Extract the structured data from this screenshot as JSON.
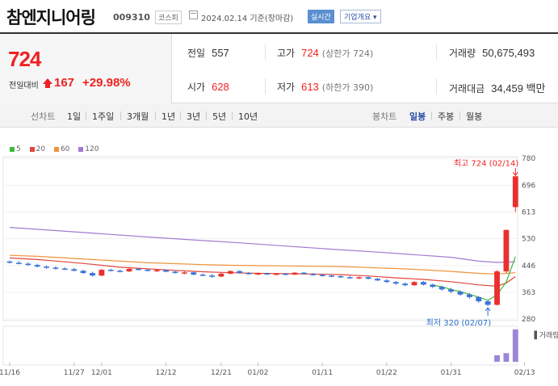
{
  "header": {
    "name": "참엔지니어링",
    "code": "009310",
    "market": "코스피",
    "date": "2024.02.14 기준(장마감)",
    "realtime": "실시간",
    "company_info": "기업개요 ▾"
  },
  "summary": {
    "price": "724",
    "change_label": "전일대비",
    "change": "167",
    "change_pct": "+29.98%",
    "prev_close": {
      "label": "전일",
      "value": "557"
    },
    "high": {
      "label": "고가",
      "value": "724",
      "extra": "(상한가 724)"
    },
    "volume": {
      "label": "거래량",
      "value": "50,675,493"
    },
    "open": {
      "label": "시가",
      "value": "628"
    },
    "low": {
      "label": "저가",
      "value": "613",
      "extra": "(하한가 390)"
    },
    "turnover": {
      "label": "거래대금",
      "value": "34,459 백만"
    }
  },
  "tabs": {
    "line_label": "선차트",
    "line_tabs": [
      "1일",
      "1주일",
      "3개월",
      "1년",
      "3년",
      "5년",
      "10년"
    ],
    "candle_label": "봉차트",
    "candle_tabs": [
      "일봉",
      "주봉",
      "월봉"
    ],
    "active_candle": "일봉"
  },
  "colors": {
    "up": "#e8312f",
    "down": "#3a73d8",
    "ma5": "#3cb83a",
    "ma20": "#e0463c",
    "ma60": "#f0923a",
    "ma120": "#a27ad0"
  },
  "chart_data": {
    "type": "candlestick",
    "legend": [
      {
        "name": "5",
        "color": "#3cb83a"
      },
      {
        "name": "20",
        "color": "#e0463c"
      },
      {
        "name": "60",
        "color": "#f0923a"
      },
      {
        "name": "120",
        "color": "#a27ad0"
      }
    ],
    "y_ticks": [
      280,
      363,
      446,
      530,
      613,
      696,
      780
    ],
    "ylim": [
      280,
      780
    ],
    "x_labels": [
      {
        "i": 0,
        "label": "11/16"
      },
      {
        "i": 7,
        "label": "11/27"
      },
      {
        "i": 10,
        "label": "12/01"
      },
      {
        "i": 17,
        "label": "12/12"
      },
      {
        "i": 23,
        "label": "12/21"
      },
      {
        "i": 27,
        "label": "01/02"
      },
      {
        "i": 34,
        "label": "01/11"
      },
      {
        "i": 41,
        "label": "01/22"
      },
      {
        "i": 48,
        "label": "01/31"
      },
      {
        "i": 56,
        "label": "02/13"
      }
    ],
    "candles": [
      [
        459,
        462,
        452,
        455
      ],
      [
        455,
        460,
        450,
        452
      ],
      [
        452,
        457,
        445,
        448
      ],
      [
        448,
        452,
        440,
        443
      ],
      [
        443,
        447,
        436,
        440
      ],
      [
        440,
        444,
        433,
        437
      ],
      [
        437,
        441,
        432,
        435
      ],
      [
        435,
        439,
        428,
        430
      ],
      [
        430,
        433,
        420,
        423
      ],
      [
        423,
        427,
        412,
        415
      ],
      [
        415,
        436,
        413,
        433
      ],
      [
        433,
        436,
        428,
        430
      ],
      [
        430,
        434,
        425,
        428
      ],
      [
        428,
        438,
        426,
        436
      ],
      [
        436,
        439,
        431,
        433
      ],
      [
        433,
        437,
        428,
        430
      ],
      [
        430,
        435,
        426,
        432
      ],
      [
        432,
        434,
        425,
        427
      ],
      [
        427,
        431,
        421,
        423
      ],
      [
        423,
        428,
        419,
        425
      ],
      [
        425,
        427,
        416,
        418
      ],
      [
        418,
        422,
        413,
        415
      ],
      [
        415,
        420,
        408,
        412
      ],
      [
        412,
        424,
        410,
        421
      ],
      [
        421,
        432,
        419,
        429
      ],
      [
        429,
        431,
        421,
        423
      ],
      [
        423,
        426,
        418,
        420
      ],
      [
        420,
        425,
        417,
        422
      ],
      [
        422,
        424,
        417,
        419
      ],
      [
        419,
        423,
        416,
        421
      ],
      [
        421,
        423,
        416,
        418
      ],
      [
        418,
        426,
        417,
        424
      ],
      [
        424,
        426,
        418,
        420
      ],
      [
        420,
        423,
        415,
        417
      ],
      [
        417,
        421,
        412,
        415
      ],
      [
        415,
        419,
        410,
        413
      ],
      [
        413,
        416,
        408,
        410
      ],
      [
        410,
        414,
        406,
        408
      ],
      [
        408,
        412,
        404,
        410
      ],
      [
        410,
        412,
        403,
        405
      ],
      [
        405,
        408,
        398,
        400
      ],
      [
        400,
        405,
        392,
        395
      ],
      [
        395,
        398,
        386,
        390
      ],
      [
        390,
        394,
        382,
        385
      ],
      [
        385,
        398,
        383,
        395
      ],
      [
        395,
        398,
        384,
        387
      ],
      [
        387,
        390,
        376,
        380
      ],
      [
        380,
        384,
        368,
        372
      ],
      [
        372,
        377,
        360,
        365
      ],
      [
        365,
        369,
        352,
        356
      ],
      [
        356,
        361,
        343,
        348
      ],
      [
        348,
        351,
        330,
        335
      ],
      [
        335,
        339,
        320,
        324
      ],
      [
        324,
        432,
        322,
        428
      ],
      [
        428,
        558,
        423,
        557
      ],
      [
        628,
        724,
        613,
        724
      ]
    ],
    "ma5": [
      [
        46,
        385
      ],
      [
        47,
        380
      ],
      [
        48,
        372
      ],
      [
        49,
        365
      ],
      [
        50,
        357
      ],
      [
        51,
        348
      ],
      [
        52,
        338
      ],
      [
        53,
        355
      ],
      [
        54,
        395
      ],
      [
        55,
        474
      ]
    ],
    "ma20": [
      [
        0,
        470
      ],
      [
        3,
        465
      ],
      [
        6,
        458
      ],
      [
        9,
        450
      ],
      [
        12,
        441
      ],
      [
        15,
        436
      ],
      [
        18,
        431
      ],
      [
        21,
        427
      ],
      [
        24,
        424
      ],
      [
        27,
        422
      ],
      [
        30,
        421
      ],
      [
        33,
        420
      ],
      [
        36,
        418
      ],
      [
        39,
        414
      ],
      [
        42,
        408
      ],
      [
        45,
        403
      ],
      [
        48,
        396
      ],
      [
        51,
        386
      ],
      [
        53,
        382
      ],
      [
        54,
        392
      ],
      [
        55,
        412
      ]
    ],
    "ma60": [
      [
        0,
        478
      ],
      [
        3,
        475
      ],
      [
        6,
        470
      ],
      [
        9,
        465
      ],
      [
        12,
        460
      ],
      [
        15,
        455
      ],
      [
        18,
        452
      ],
      [
        21,
        449
      ],
      [
        24,
        447
      ],
      [
        27,
        446
      ],
      [
        30,
        445
      ],
      [
        33,
        444
      ],
      [
        36,
        443
      ],
      [
        39,
        440
      ],
      [
        42,
        437
      ],
      [
        45,
        433
      ],
      [
        48,
        428
      ],
      [
        51,
        422
      ],
      [
        53,
        420
      ],
      [
        55,
        424
      ]
    ],
    "ma120": [
      [
        0,
        565
      ],
      [
        5,
        555
      ],
      [
        10,
        545
      ],
      [
        15,
        535
      ],
      [
        20,
        526
      ],
      [
        25,
        517
      ],
      [
        30,
        507
      ],
      [
        35,
        497
      ],
      [
        40,
        488
      ],
      [
        45,
        478
      ],
      [
        48,
        472
      ],
      [
        51,
        460
      ],
      [
        53,
        456
      ],
      [
        55,
        458
      ]
    ],
    "volume": [
      {
        "i": 53,
        "v": 3
      },
      {
        "i": 54,
        "v": 4
      },
      {
        "i": 55,
        "v": 15
      }
    ],
    "volume_label": "거래량",
    "annotations": {
      "high": {
        "i": 55,
        "text": "최고 724 (02/14)"
      },
      "low": {
        "i": 52,
        "text": "최저 320 (02/07)"
      }
    }
  }
}
